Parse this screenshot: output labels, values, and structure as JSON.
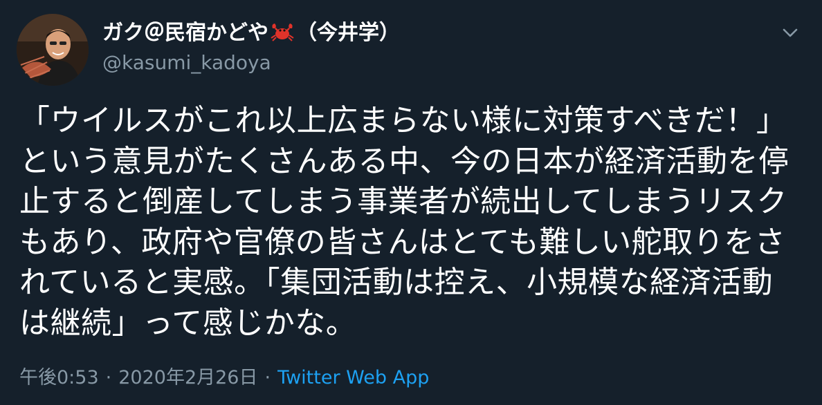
{
  "tweet": {
    "display_name": "ガク＠民宿かどや",
    "display_name_suffix": "（今井学）",
    "crab_icon": "crab-emoji",
    "handle": "@kasumi_kadoya",
    "text": "「ウイルスがこれ以上広まらない様に対策すべきだ！」という意見がたくさんある中、今の日本が経済活動を停止すると倒産してしまう事業者が続出してしまうリスクもあり、政府や官僚の皆さんはとても難しい舵取りをされていると実感。「集団活動は控え、小規模な経済活動は継続」って感じかな。",
    "time": "午後0:53",
    "date": "2020年2月26日",
    "separator": "·",
    "source": "Twitter Web App",
    "caret_icon": "chevron-down-icon"
  },
  "colors": {
    "background": "#15202b",
    "text_primary": "#ffffff",
    "text_secondary": "#8899a6",
    "link": "#1da1f2",
    "crab": "#e0332a"
  }
}
